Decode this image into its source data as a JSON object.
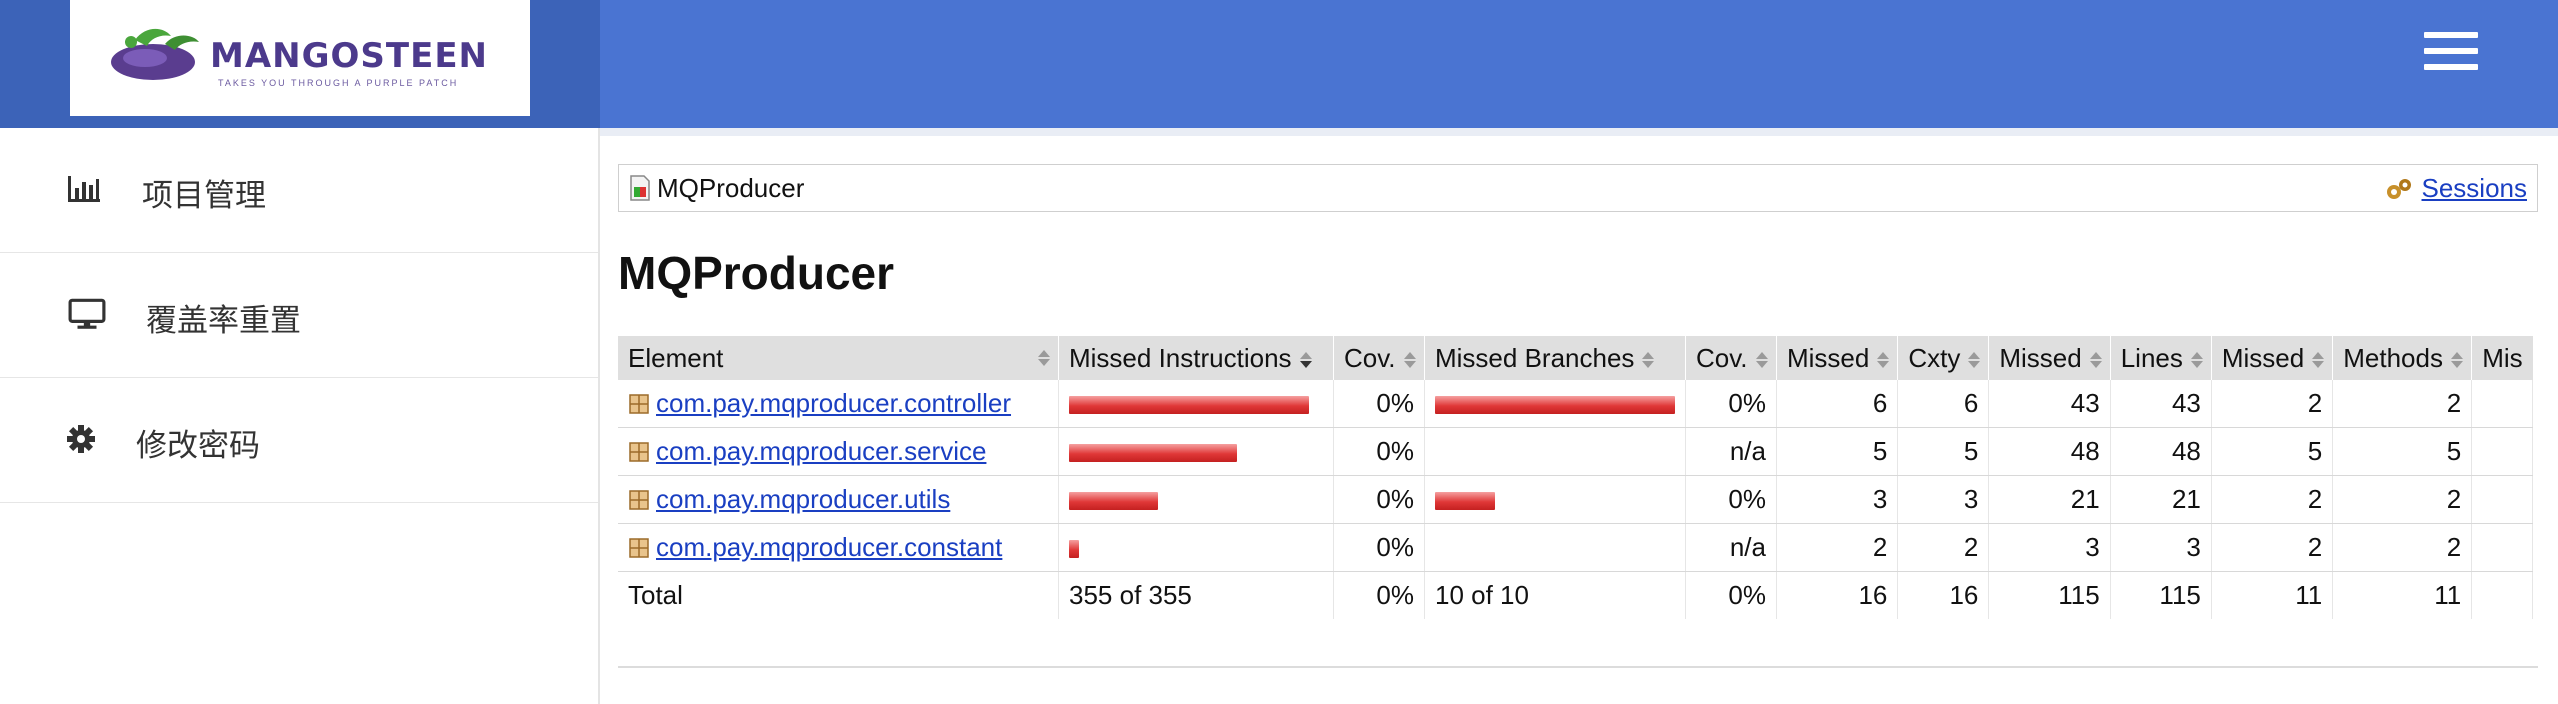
{
  "brand": {
    "name": "MANGOSTEEN",
    "tagline": "TAKES YOU THROUGH A PURPLE PATCH",
    "colors": {
      "header": "#4a74d2",
      "header_left": "#3c63b8",
      "bar": "#e03838",
      "link": "#1a3fc2"
    }
  },
  "header": {
    "menu_icon": "hamburger-icon"
  },
  "sidebar": {
    "items": [
      {
        "label": "项目管理",
        "icon": "bar-chart-icon"
      },
      {
        "label": "覆盖率重置",
        "icon": "monitor-icon"
      },
      {
        "label": "修改密码",
        "icon": "gear-icon"
      }
    ]
  },
  "breadcrumb": {
    "current": "MQProducer",
    "sessions_link": "Sessions"
  },
  "page": {
    "title": "MQProducer"
  },
  "table": {
    "columns": [
      "Element",
      "Missed Instructions",
      "Cov.",
      "Missed Branches",
      "Cov.",
      "Missed",
      "Cxty",
      "Missed",
      "Lines",
      "Missed",
      "Methods",
      "Mis"
    ],
    "rows": [
      {
        "element": "com.pay.mqproducer.controller",
        "instr_missed_fraction": 1.0,
        "instr_cov": "0%",
        "branch_missed_fraction": 1.0,
        "branch_cov": "0%",
        "cxty_missed": "6",
        "cxty": "6",
        "lines_missed": "43",
        "lines": "43",
        "methods_missed": "2",
        "methods": "2"
      },
      {
        "element": "com.pay.mqproducer.service",
        "instr_missed_fraction": 0.7,
        "instr_cov": "0%",
        "branch_missed_fraction": 0,
        "branch_cov": "n/a",
        "cxty_missed": "5",
        "cxty": "5",
        "lines_missed": "48",
        "lines": "48",
        "methods_missed": "5",
        "methods": "5"
      },
      {
        "element": "com.pay.mqproducer.utils",
        "instr_missed_fraction": 0.37,
        "instr_cov": "0%",
        "branch_missed_fraction": 0.25,
        "branch_cov": "0%",
        "cxty_missed": "3",
        "cxty": "3",
        "lines_missed": "21",
        "lines": "21",
        "methods_missed": "2",
        "methods": "2"
      },
      {
        "element": "com.pay.mqproducer.constant",
        "instr_missed_fraction": 0.04,
        "instr_cov": "0%",
        "branch_missed_fraction": 0,
        "branch_cov": "n/a",
        "cxty_missed": "2",
        "cxty": "2",
        "lines_missed": "3",
        "lines": "3",
        "methods_missed": "2",
        "methods": "2"
      }
    ],
    "total": {
      "label": "Total",
      "instr": "355 of 355",
      "instr_cov": "0%",
      "branches": "10 of 10",
      "branch_cov": "0%",
      "cxty_missed": "16",
      "cxty": "16",
      "lines_missed": "115",
      "lines": "115",
      "methods_missed": "11",
      "methods": "11"
    }
  }
}
